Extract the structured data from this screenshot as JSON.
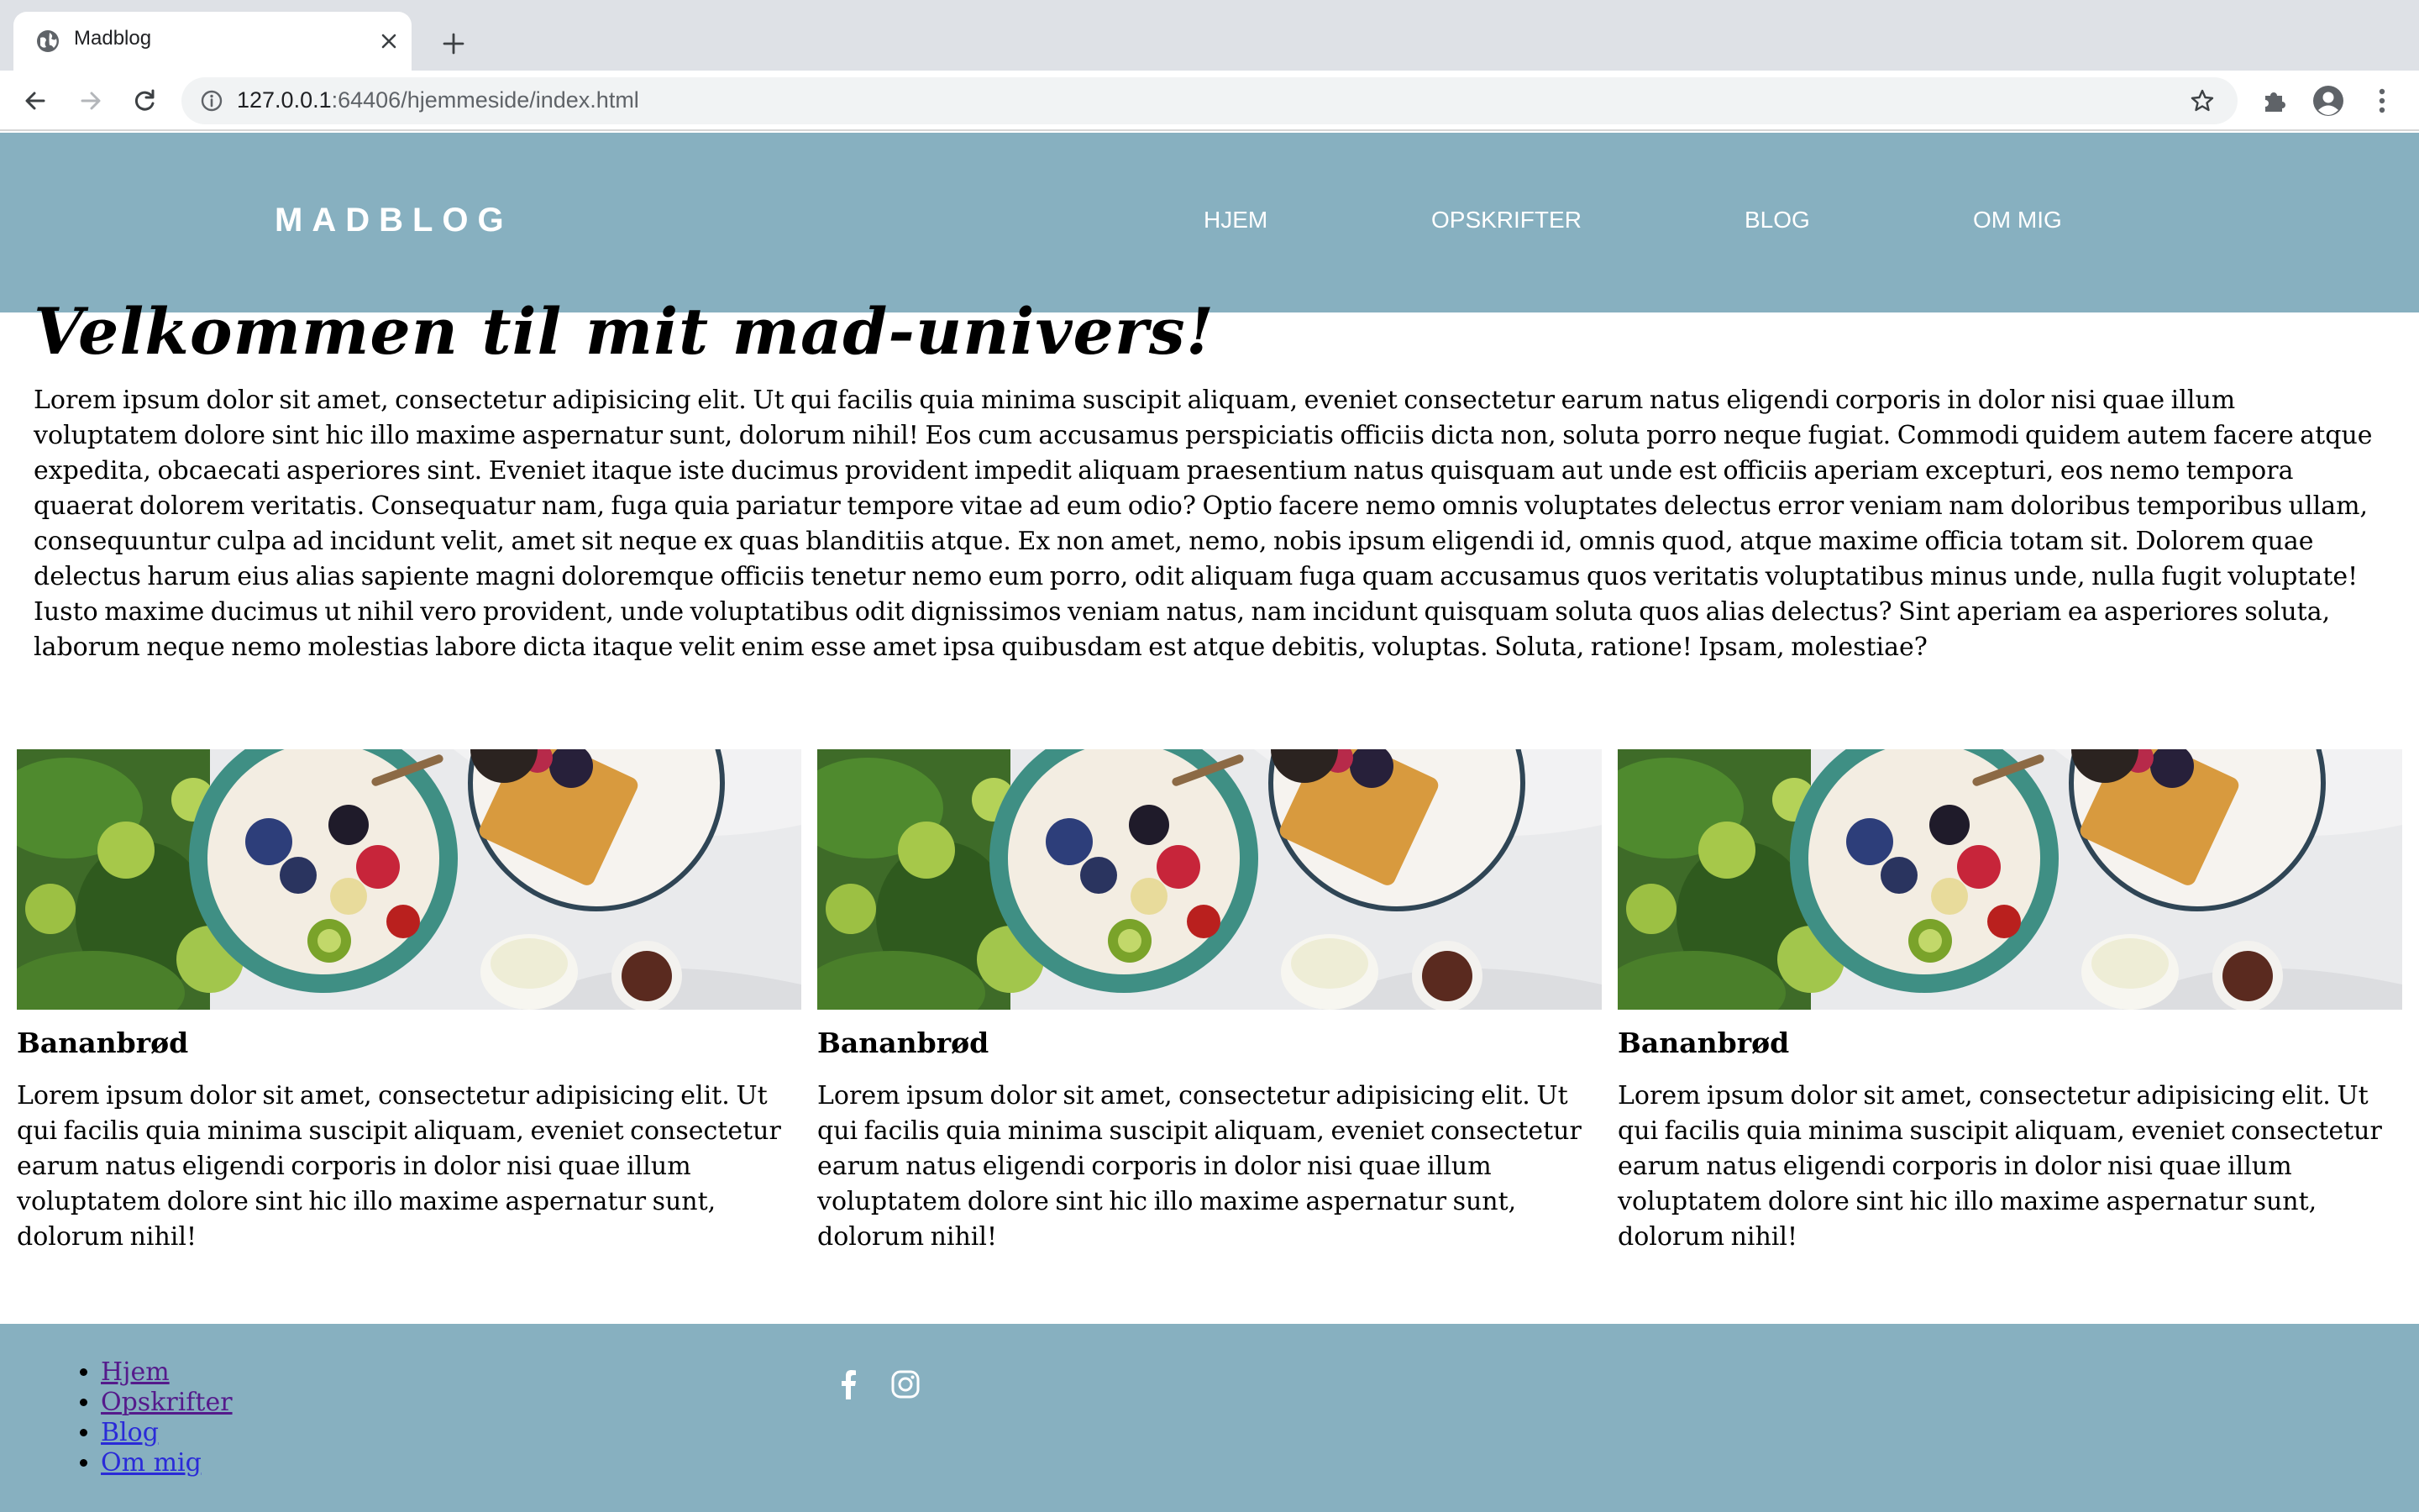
{
  "browser": {
    "tab_title": "Madblog",
    "url_host": "127.0.0.1",
    "url_rest": ":64406/hjemmeside/index.html"
  },
  "site": {
    "logo": "MADBLOG",
    "nav": [
      "HJEM",
      "OPSKRIFTER",
      "BLOG",
      "OM MIG"
    ],
    "intro_title": "Velkommen til mit mad-univers!",
    "intro_text": "Lorem ipsum dolor sit amet, consectetur adipisicing elit. Ut qui facilis quia minima suscipit aliquam, eveniet consectetur earum natus eligendi corporis in dolor nisi quae illum voluptatem dolore sint hic illo maxime aspernatur sunt, dolorum nihil! Eos cum accusamus perspiciatis officiis dicta non, soluta porro neque fugiat. Commodi quidem autem facere atque expedita, obcaecati asperiores sint. Eveniet itaque iste ducimus provident impedit aliquam praesentium natus quisquam aut unde est officiis aperiam excepturi, eos nemo tempora quaerat dolorem veritatis. Consequatur nam, fuga quia pariatur tempore vitae ad eum odio? Optio facere nemo omnis voluptates delectus error veniam nam doloribus temporibus ullam, consequuntur culpa ad incidunt velit, amet sit neque ex quas blanditiis atque. Ex non amet, nemo, nobis ipsum eligendi id, omnis quod, atque maxime officia totam sit. Dolorem quae delectus harum eius alias sapiente magni doloremque officiis tenetur nemo eum porro, odit aliquam fuga quam accusamus quos veritatis voluptatibus minus unde, nulla fugit voluptate! Iusto maxime ducimus ut nihil vero provident, unde voluptatibus odit dignissimos veniam natus, nam incidunt quisquam soluta quos alias delectus? Sint aperiam ea asperiores soluta, laborum neque nemo molestias labore dicta itaque velit enim esse amet ipsa quibusdam est atque debitis, voluptas. Soluta, ratione! Ipsam, molestiae?",
    "cards": [
      {
        "title": "Bananbrød",
        "text": "Lorem ipsum dolor sit amet, consectetur adipisicing elit. Ut qui facilis quia minima suscipit aliquam, eveniet consectetur earum natus eligendi corporis in dolor nisi quae illum voluptatem dolore sint hic illo maxime aspernatur sunt, dolorum nihil!"
      },
      {
        "title": "Bananbrød",
        "text": "Lorem ipsum dolor sit amet, consectetur adipisicing elit. Ut qui facilis quia minima suscipit aliquam, eveniet consectetur earum natus eligendi corporis in dolor nisi quae illum voluptatem dolore sint hic illo maxime aspernatur sunt, dolorum nihil!"
      },
      {
        "title": "Bananbrød",
        "text": "Lorem ipsum dolor sit amet, consectetur adipisicing elit. Ut qui facilis quia minima suscipit aliquam, eveniet consectetur earum natus eligendi corporis in dolor nisi quae illum voluptatem dolore sint hic illo maxime aspernatur sunt, dolorum nihil!"
      }
    ],
    "footer_links": [
      "Hjem",
      "Opskrifter",
      "Blog",
      "Om mig"
    ],
    "social_icons": [
      "facebook-icon",
      "instagram-icon"
    ]
  },
  "colors": {
    "header_bg": "#87b0c0",
    "footer_bg": "#87b0c0",
    "link": "#2a2ad8",
    "visited_link": "#551a8b"
  }
}
